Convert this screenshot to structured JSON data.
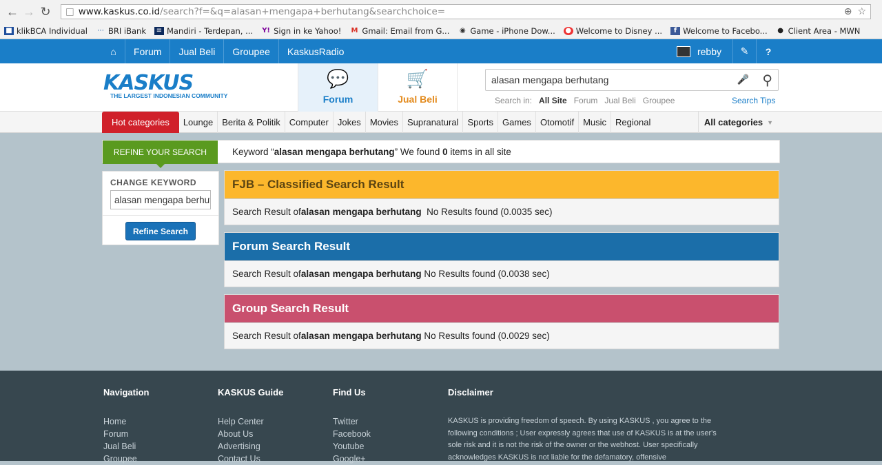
{
  "browser": {
    "url_host": "www.kaskus.co.id",
    "url_path": "/search?f=&q=alasan+mengapa+berhutang&searchchoice=",
    "bookmarks": [
      "klikBCA Individual",
      "BRI iBank",
      "Mandiri - Terdepan, ...",
      "Sign in ke Yahoo!",
      "Gmail: Email from G...",
      "Game - iPhone Dow...",
      "Welcome to Disney ...",
      "Welcome to Facebo...",
      "Client Area - MWN"
    ]
  },
  "topnav": {
    "items": [
      "Forum",
      "Jual Beli",
      "Groupee",
      "KaskusRadio"
    ],
    "username": "rebby"
  },
  "header": {
    "logo_text": "KASKUS",
    "logo_tagline": "THE LARGEST INDONESIAN COMMUNITY",
    "tab_forum": "Forum",
    "tab_jualbeli": "Jual Beli",
    "search_value": "alasan mengapa berhutang",
    "search_in_label": "Search in:",
    "search_in": [
      "All Site",
      "Forum",
      "Jual Beli",
      "Groupee"
    ],
    "search_tips": "Search Tips"
  },
  "categories": {
    "hot": "Hot categories",
    "items": [
      "Lounge",
      "Berita & Politik",
      "Computer",
      "Jokes",
      "Movies",
      "Supranatural",
      "Sports",
      "Games",
      "Otomotif",
      "Music",
      "Regional"
    ],
    "all": "All categories"
  },
  "refine": {
    "label": "REFINE YOUR SEARCH",
    "msg_prefix": "Keyword “",
    "keyword": "alasan mengapa berhutang",
    "msg_mid": "” We found ",
    "count": "0",
    "msg_suffix": " items in all site"
  },
  "sidebar": {
    "heading": "CHANGE KEYWORD",
    "input_value": "alasan mengapa berhutang",
    "button": "Refine Search"
  },
  "results": [
    {
      "title": "FJB – Classified Search Result",
      "prefix": "Search Result of ",
      "keyword": "alasan mengapa berhutang",
      "status": "  No Results found (0.0035 sec)"
    },
    {
      "title": "Forum Search Result",
      "prefix": "Search Result of ",
      "keyword": "alasan mengapa berhutang",
      "status": " No Results found (0.0038 sec)"
    },
    {
      "title": "Group Search Result",
      "prefix": "Search Result of ",
      "keyword": "alasan mengapa berhutang",
      "status": " No Results found (0.0029 sec)"
    }
  ],
  "footer": {
    "nav_title": "Navigation",
    "nav": [
      "Home",
      "Forum",
      "Jual Beli",
      "Groupee"
    ],
    "guide_title": "KASKUS Guide",
    "guide": [
      "Help Center",
      "About Us",
      "Advertising",
      "Contact Us"
    ],
    "find_title": "Find Us",
    "find": [
      "Twitter",
      "Facebook",
      "Youtube",
      "Google+"
    ],
    "disclaimer_title": "Disclaimer",
    "disclaimer": "KASKUS is providing freedom of speech. By using KASKUS , you agree to the following conditions ; User expressly agrees that use of KASKUS is at the user's sole risk and it is not the risk of the owner or the webhost. User specifically acknowledges KASKUS is not liable for the defamatory, offensive"
  },
  "colors": {
    "brand_blue": "#1a7ec8",
    "hot_red": "#d0202a",
    "fjb_yellow": "#fcb72c",
    "forum_blue": "#1b6ea9",
    "group_pink": "#c9506e",
    "refine_green": "#5a9a1f"
  }
}
